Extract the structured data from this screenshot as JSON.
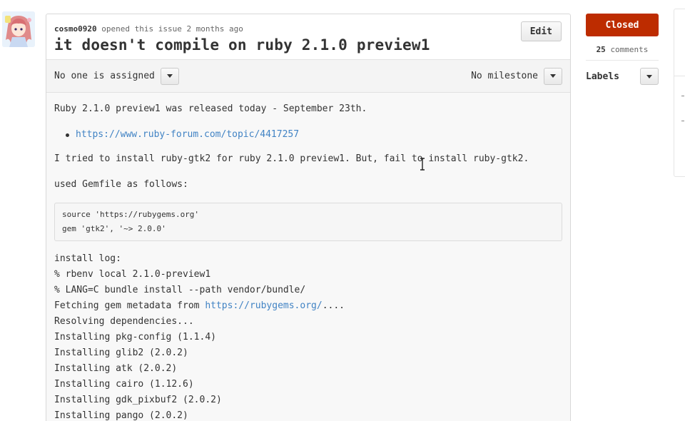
{
  "issue": {
    "author": "cosmo0920",
    "opened_text": "opened this issue 2 months ago",
    "title": "it doesn't compile on ruby 2.1.0 preview1",
    "edit_label": "Edit",
    "assignee_text": "No one is assigned",
    "milestone_text": "No milestone"
  },
  "body": {
    "para1": "Ruby 2.1.0 preview1 was released today - September 23th.",
    "link1": "https://www.ruby-forum.com/topic/4417257",
    "para2": "I tried to install ruby-gtk2 for ruby 2.1.0 preview1. But, fail to install ruby-gtk2.",
    "para3": "used Gemfile as follows:",
    "code_lines": [
      "source 'https://rubygems.org'",
      "gem 'gtk2', '~> 2.0.0'"
    ],
    "log_heading": "install log:",
    "log_lines": [
      "% rbenv local 2.1.0-preview1",
      "% LANG=C bundle install --path vendor/bundle/"
    ],
    "fetching_prefix": "Fetching gem metadata from ",
    "fetching_link": "https://rubygems.org/",
    "fetching_suffix": "....",
    "log_lines_after": [
      "Resolving dependencies...",
      "Installing pkg-config (1.1.4)",
      "Installing glib2 (2.0.2)",
      "Installing atk (2.0.2)",
      "Installing cairo (1.12.6)",
      "Installing gdk_pixbuf2 (2.0.2)",
      "Installing pango (2.0.2)"
    ]
  },
  "sidebar": {
    "status_label": "Closed",
    "comment_count": "25",
    "comment_word": "comments",
    "labels_heading": "Labels"
  },
  "colors": {
    "closed": "#bd2c00",
    "link": "#4183c4"
  },
  "icons": [
    "avatar-image",
    "caret-down-icon",
    "text-cursor-icon"
  ]
}
